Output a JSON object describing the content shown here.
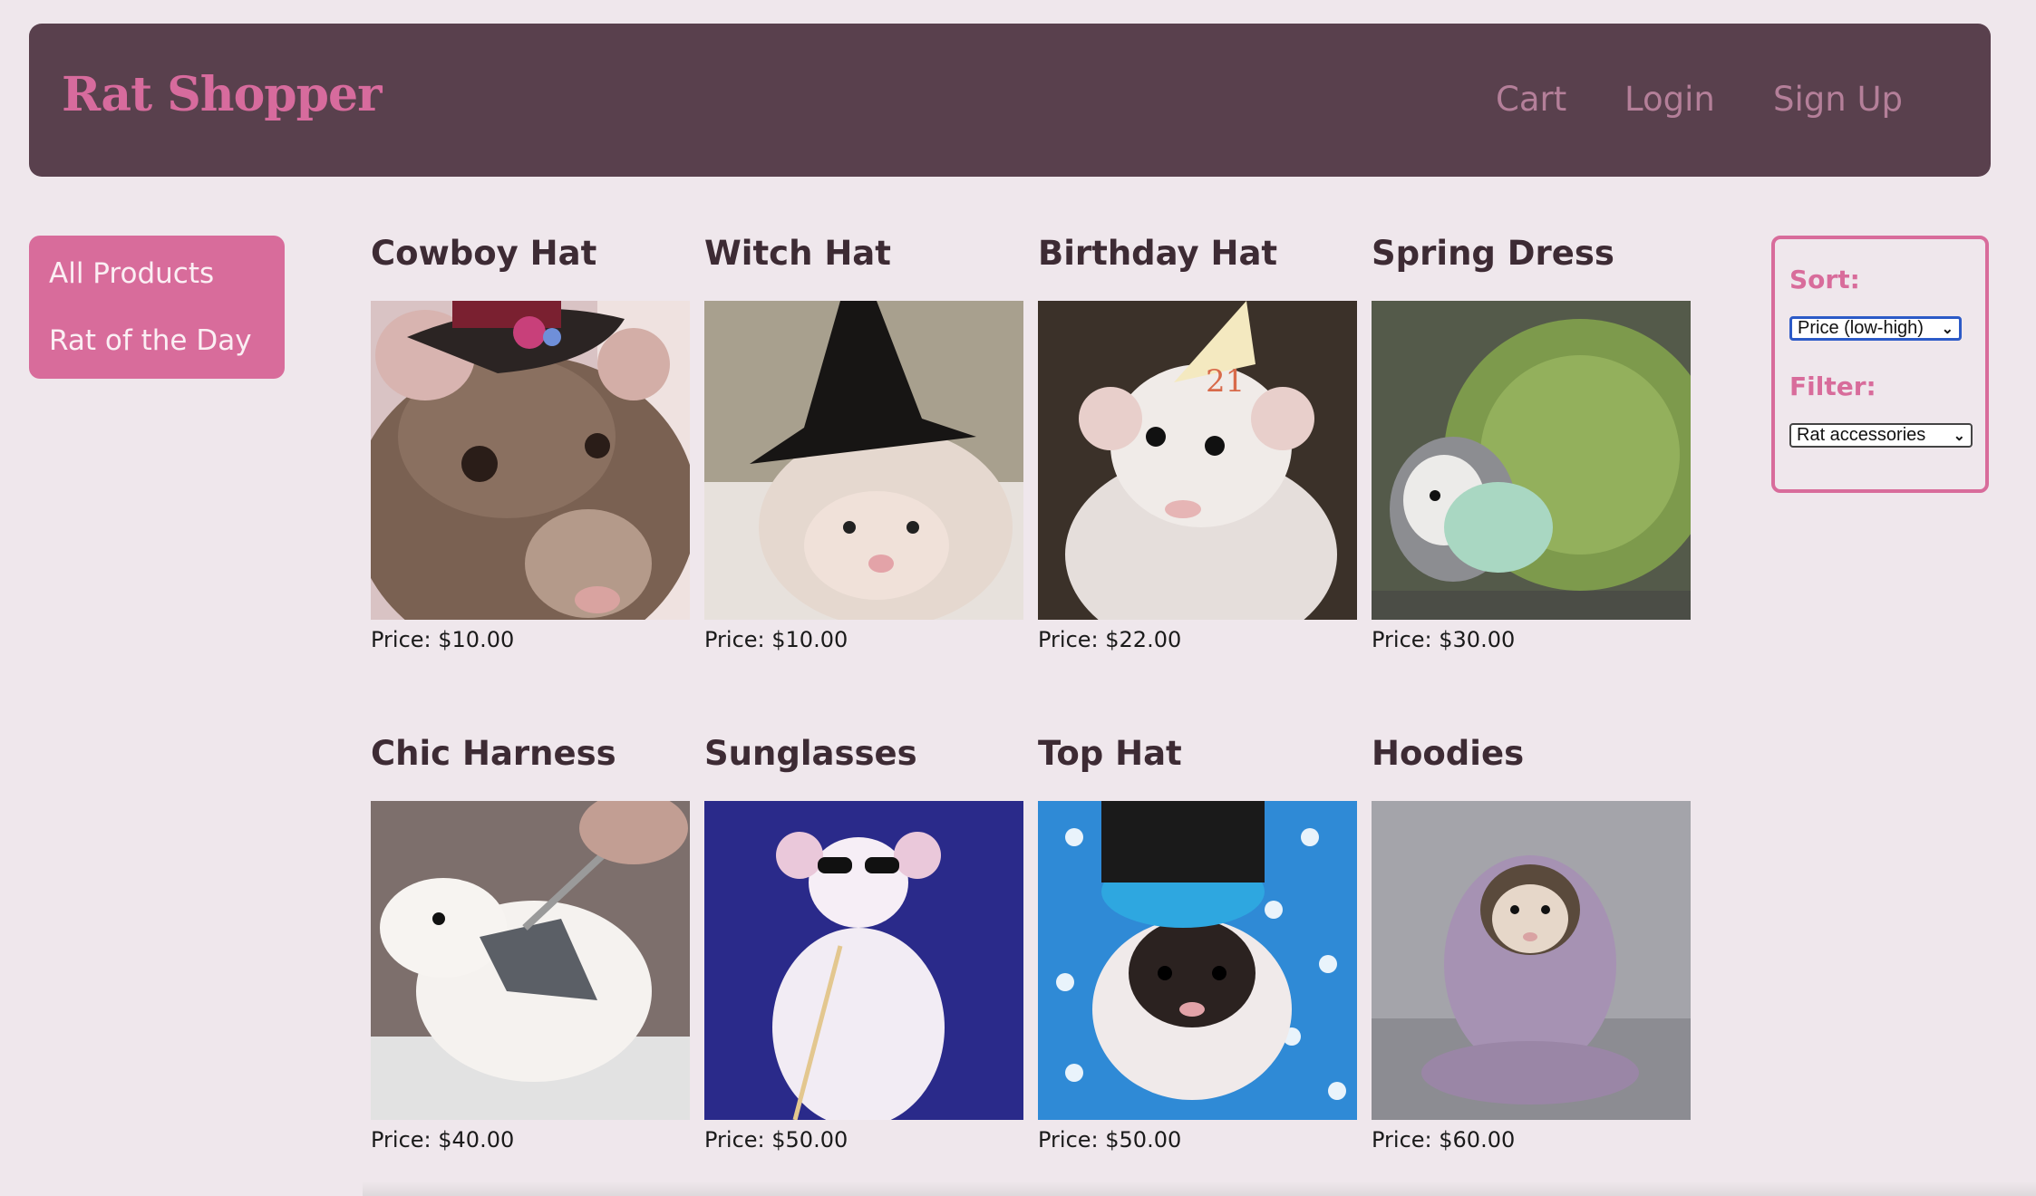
{
  "header": {
    "brand": "Rat Shopper",
    "nav": [
      "Cart",
      "Login",
      "Sign Up"
    ]
  },
  "sidebar": {
    "items": [
      "All Products",
      "Rat of the Day"
    ]
  },
  "products": [
    {
      "title": "Cowboy Hat",
      "price": "Price: $10.00"
    },
    {
      "title": "Witch Hat",
      "price": "Price: $10.00"
    },
    {
      "title": "Birthday Hat",
      "price": "Price: $22.00"
    },
    {
      "title": "Spring Dress",
      "price": "Price: $30.00"
    },
    {
      "title": "Chic Harness",
      "price": "Price: $40.00"
    },
    {
      "title": "Sunglasses",
      "price": "Price: $50.00"
    },
    {
      "title": "Top Hat",
      "price": "Price: $50.00"
    },
    {
      "title": "Hoodies",
      "price": "Price: $60.00"
    }
  ],
  "controls": {
    "sort_label": "Sort:",
    "sort_value": "Price (low-high)",
    "filter_label": "Filter:",
    "filter_value": "Rat accessories"
  },
  "colors": {
    "accent": "#d86c9b",
    "navbar": "#59404d",
    "background": "#efe7ec"
  }
}
